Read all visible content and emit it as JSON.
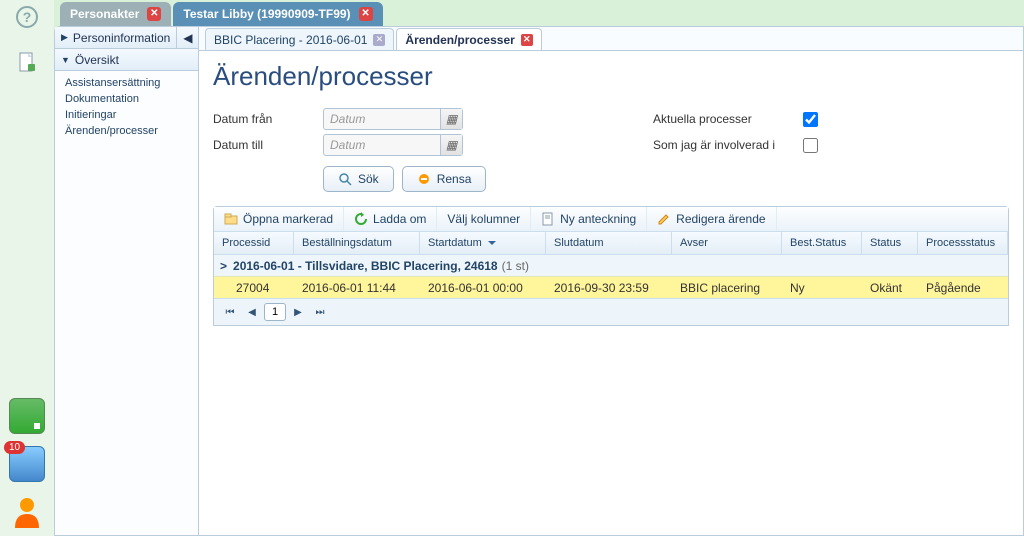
{
  "top_tabs": {
    "inactive": "Personakter",
    "active": "Testar Libby (19990909-TF99)"
  },
  "sidebar": {
    "personinfo": "Personinformation",
    "oversikt": "Översikt",
    "items": [
      "Assistansersättning",
      "Dokumentation",
      "Initieringar",
      "Ärenden/processer"
    ]
  },
  "sub_tabs": {
    "prev": "BBIC Placering - 2016-06-01",
    "active": "Ärenden/processer"
  },
  "page_title": "Ärenden/processer",
  "filters": {
    "fran_label": "Datum från",
    "till_label": "Datum till",
    "placeholder": "Datum",
    "aktuella_label": "Aktuella processer",
    "involverad_label": "Som jag är involverad i",
    "aktuella_checked": true,
    "involverad_checked": false
  },
  "buttons": {
    "sok": "Sök",
    "rensa": "Rensa"
  },
  "toolbar": {
    "oppna": "Öppna markerad",
    "ladda": "Ladda om",
    "valj": "Välj kolumner",
    "ny": "Ny anteckning",
    "redigera": "Redigera ärende"
  },
  "headers": {
    "processid": "Processid",
    "best": "Beställningsdatum",
    "start": "Startdatum",
    "slut": "Slutdatum",
    "avser": "Avser",
    "bstat": "Best.Status",
    "stat": "Status",
    "pstat": "Processstatus"
  },
  "group": {
    "label": "2016-06-01 - Tillsvidare, BBIC Placering, 24618",
    "count": "(1 st)"
  },
  "row": {
    "processid": "27004",
    "best": "2016-06-01 11:44",
    "start": "2016-06-01 00:00",
    "slut": "2016-09-30 23:59",
    "avser": "BBIC placering",
    "bstat": "Ny",
    "stat": "Okänt",
    "pstat": "Pågående"
  },
  "pager": {
    "page": "1"
  },
  "rail_badge": "10"
}
